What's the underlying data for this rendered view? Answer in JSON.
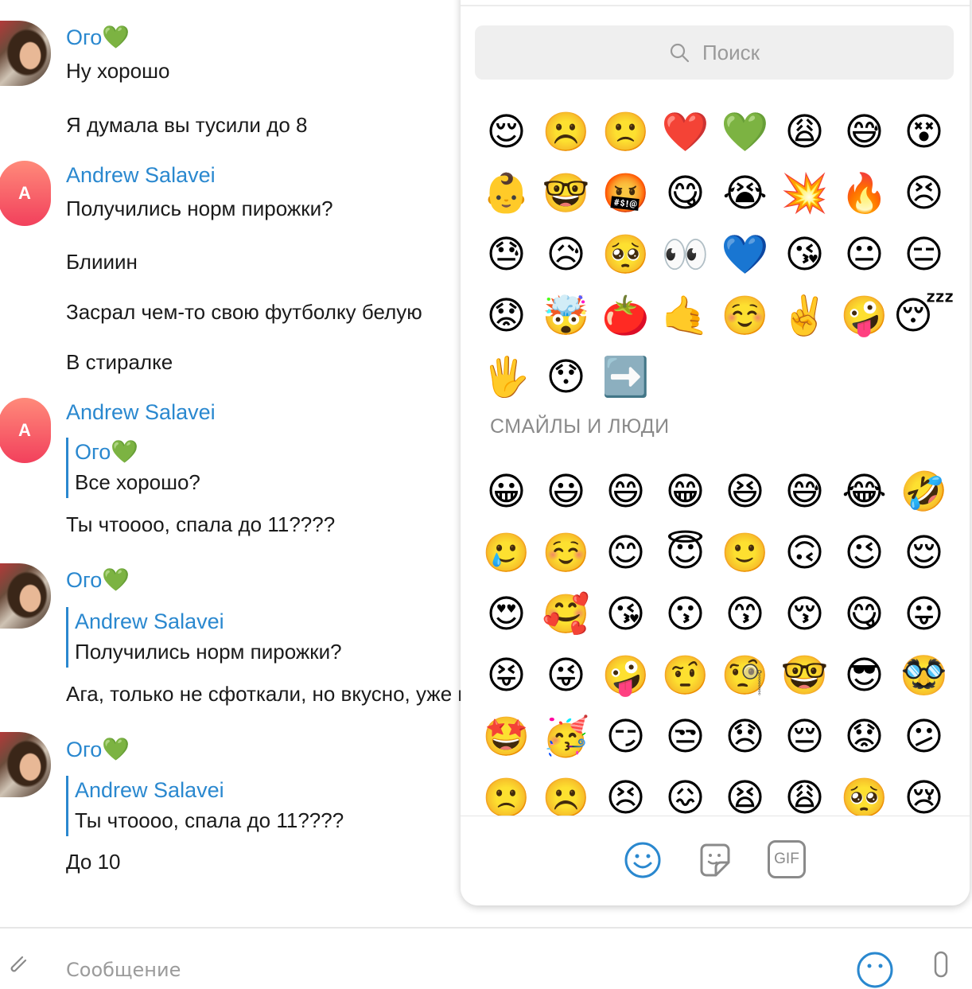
{
  "chat": {
    "messages": [
      {
        "sender": "Ого",
        "heart": "💚",
        "lines": [
          "Ну хорошо",
          "Я думала вы тусили до 8"
        ]
      },
      {
        "sender": "Andrew Salavei",
        "avatar_letter": "A",
        "lines": [
          "Получились норм пирожки?",
          "Блииин",
          "Засрал чем-то свою футболку белую",
          "В стиралке"
        ]
      },
      {
        "sender": "Andrew Salavei",
        "avatar_letter": "A",
        "quote": {
          "name": "Ого",
          "heart": "💚",
          "text": "Все хорошо?"
        },
        "lines": [
          "Ты чтоооо, спала до 11????"
        ]
      },
      {
        "sender": "Ого",
        "heart": "💚",
        "quote": {
          "name": "Andrew Salavei",
          "text": "Получились норм пирожки?"
        },
        "lines": [
          "Ага, только не сфоткали, но вкусно, уже вс"
        ]
      },
      {
        "sender": "Ого",
        "heart": "💚",
        "quote": {
          "name": "Andrew Salavei",
          "text": "Ты чтоооо, спала до 11????"
        },
        "lines": [
          "До 10"
        ]
      }
    ]
  },
  "composer": {
    "placeholder": "Сообщение"
  },
  "emoji_panel": {
    "search_placeholder": "Поиск",
    "recent": [
      "😌",
      "☹️",
      "🙁",
      "❤️",
      "💚",
      "😩",
      "😅",
      "😵",
      "👶",
      "🤓",
      "🤬",
      "😋",
      "😭",
      "💥",
      "🔥",
      "😣",
      "😓",
      "😥",
      "🥺",
      "👀",
      "💙",
      "😘",
      "😐",
      "😑",
      "😟",
      "🤯",
      "🍅",
      "🤙",
      "☺️",
      "✌️",
      "🤪",
      "😴",
      "🖐️",
      "😯",
      "➡️"
    ],
    "section_title": "СМАЙЛЫ И ЛЮДИ",
    "people": [
      "😀",
      "😃",
      "😄",
      "😁",
      "😆",
      "😅",
      "😂",
      "🤣",
      "🥲",
      "☺️",
      "😊",
      "😇",
      "🙂",
      "🙃",
      "😉",
      "😌",
      "😍",
      "🥰",
      "😘",
      "😗",
      "😙",
      "😚",
      "😋",
      "😛",
      "😝",
      "😜",
      "🤪",
      "🤨",
      "🧐",
      "🤓",
      "😎",
      "🥸",
      "🤩",
      "🥳",
      "😏",
      "😒",
      "😞",
      "😔",
      "😟",
      "😕",
      "🙁",
      "☹️",
      "😣",
      "😖",
      "😫",
      "😩",
      "🥺",
      "😢"
    ],
    "tabs": [
      "smileys",
      "stickers",
      "GIF"
    ]
  },
  "colors": {
    "accent": "#2a88cf",
    "heart": "#2fb843",
    "avatar_gradient_top": "#ff8a7a",
    "avatar_gradient_bottom": "#f2405c"
  }
}
